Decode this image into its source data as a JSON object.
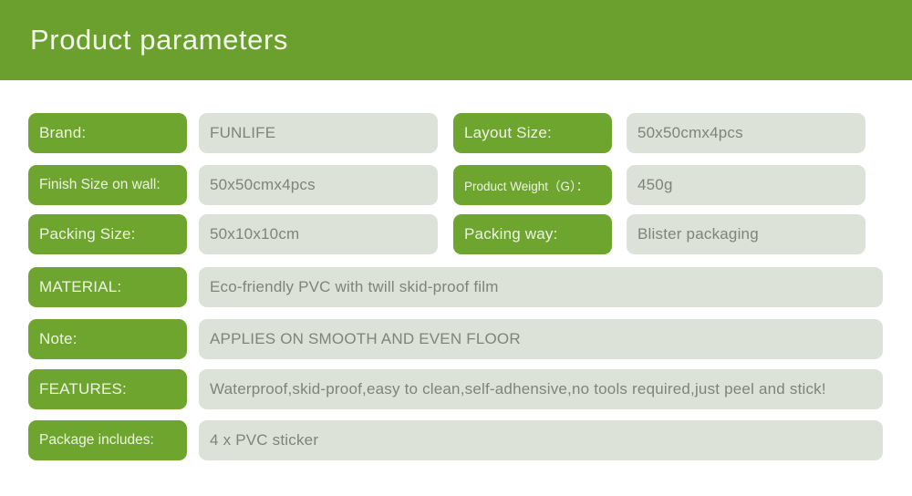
{
  "header": {
    "title": "Product parameters",
    "background_color": "#6ba02f",
    "title_color": "#f2f6ec"
  },
  "theme": {
    "pill_color": "#6ea52e",
    "pill_text_color": "#eef4e4",
    "value_box_color": "#dde2d9",
    "value_text_color": "#7e8479",
    "page_background": "#ffffff"
  },
  "spec_rows": [
    {
      "layout": "two-column",
      "left": {
        "label": "Brand:",
        "value": "FUNLIFE"
      },
      "right": {
        "label": "Layout Size:",
        "value": "50x50cmx4pcs"
      }
    },
    {
      "layout": "two-column",
      "left": {
        "label": "Finish Size on wall:",
        "value": "50x50cmx4pcs"
      },
      "right": {
        "label": "Product Weight（G）：",
        "value": "450g"
      }
    },
    {
      "layout": "two-column",
      "left": {
        "label": "Packing Size:",
        "value": "50x10x10cm"
      },
      "right": {
        "label": "Packing way:",
        "value": "Blister packaging"
      }
    },
    {
      "layout": "full-width",
      "left": {
        "label": "MATERIAL:",
        "value": "Eco-friendly PVC with twill skid-proof film"
      }
    },
    {
      "layout": "full-width",
      "left": {
        "label": "Note:",
        "value": "APPLIES ON SMOOTH AND EVEN FLOOR"
      }
    },
    {
      "layout": "full-width",
      "left": {
        "label": "FEATURES:",
        "value": "Waterproof,skid-proof,easy to clean,self-adhensive,no tools required,just peel and stick!"
      }
    },
    {
      "layout": "full-width",
      "left": {
        "label": "Package includes:",
        "value": "4 x PVC sticker"
      }
    }
  ]
}
